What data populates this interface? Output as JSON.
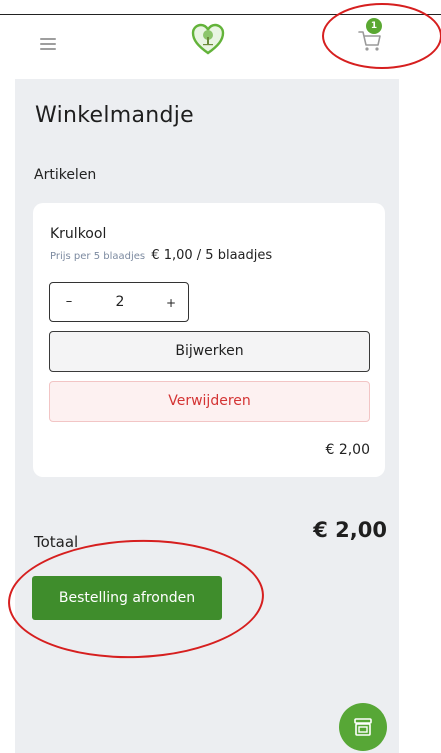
{
  "header": {
    "menu_icon": "hamburger-menu-icon",
    "logo_icon": "heart-tree-logo",
    "cart_icon": "shopping-cart-icon",
    "cart_count": "1"
  },
  "page": {
    "title": "Winkelmandje",
    "section_label": "Artikelen"
  },
  "cart_item": {
    "name": "Krulkool",
    "price_label": "Prijs per 5 blaadjes",
    "price_value": "€ 1,00 / 5 blaadjes",
    "quantity": "2",
    "minus_label": "–",
    "plus_label": "+",
    "update_label": "Bijwerken",
    "remove_label": "Verwijderen",
    "line_total": "€ 2,00"
  },
  "summary": {
    "total_label": "Totaal",
    "total_value": "€ 2,00"
  },
  "actions": {
    "checkout_label": "Bestelling afronden",
    "store_icon": "store-icon"
  },
  "colors": {
    "brand_green": "#3f8d2c",
    "fab_green": "#57a736",
    "danger_red": "#d43434",
    "annotation_red": "#d61f1f"
  }
}
